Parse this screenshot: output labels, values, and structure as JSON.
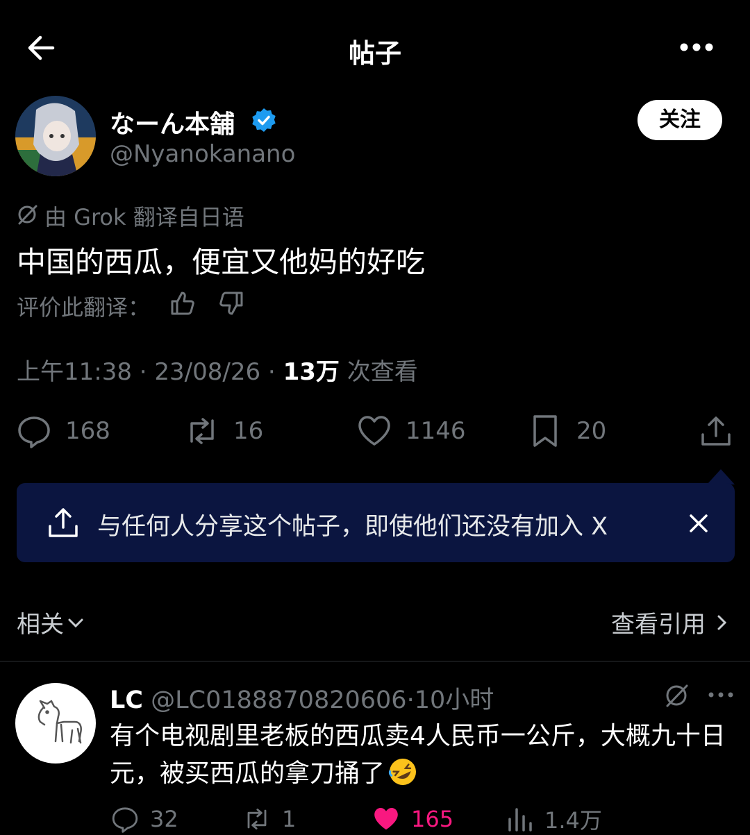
{
  "header": {
    "title": "帖子"
  },
  "author": {
    "name": "なーん本舗",
    "handle": "@Nyanokanano",
    "follow_label": "关注"
  },
  "translation": {
    "note": "由 Grok 翻译自日语",
    "text": "中国的西瓜，便宜又他妈的好吃",
    "rate_label": "评价此翻译："
  },
  "meta": {
    "time": "上午11:38",
    "sep1": " · ",
    "date": "23/08/26",
    "sep2": " · ",
    "views": "13万",
    "views_label": " 次查看"
  },
  "actions": {
    "replies": "168",
    "reposts": "16",
    "likes": "1146",
    "bookmarks": "20"
  },
  "share_banner": {
    "text": "与任何人分享这个帖子，即使他们还没有加入 X"
  },
  "related": {
    "label": "相关",
    "view_quotes": "查看引用"
  },
  "reply": {
    "name": "LC",
    "handle": "@LC0188870820606",
    "sep": "·",
    "time": "10小时",
    "text": "有个电视剧里老板的西瓜卖4人民币一公斤，大概九十日元，被买西瓜的拿刀捅了",
    "emoji": "rolling-on-floor-laughing",
    "replies": "32",
    "reposts": "1",
    "likes": "165",
    "views": "1.4万"
  },
  "colors": {
    "background": "#000000",
    "muted": "#71767b",
    "verified": "#1d9bf0",
    "like": "#f91880",
    "banner": "#0b1540"
  }
}
